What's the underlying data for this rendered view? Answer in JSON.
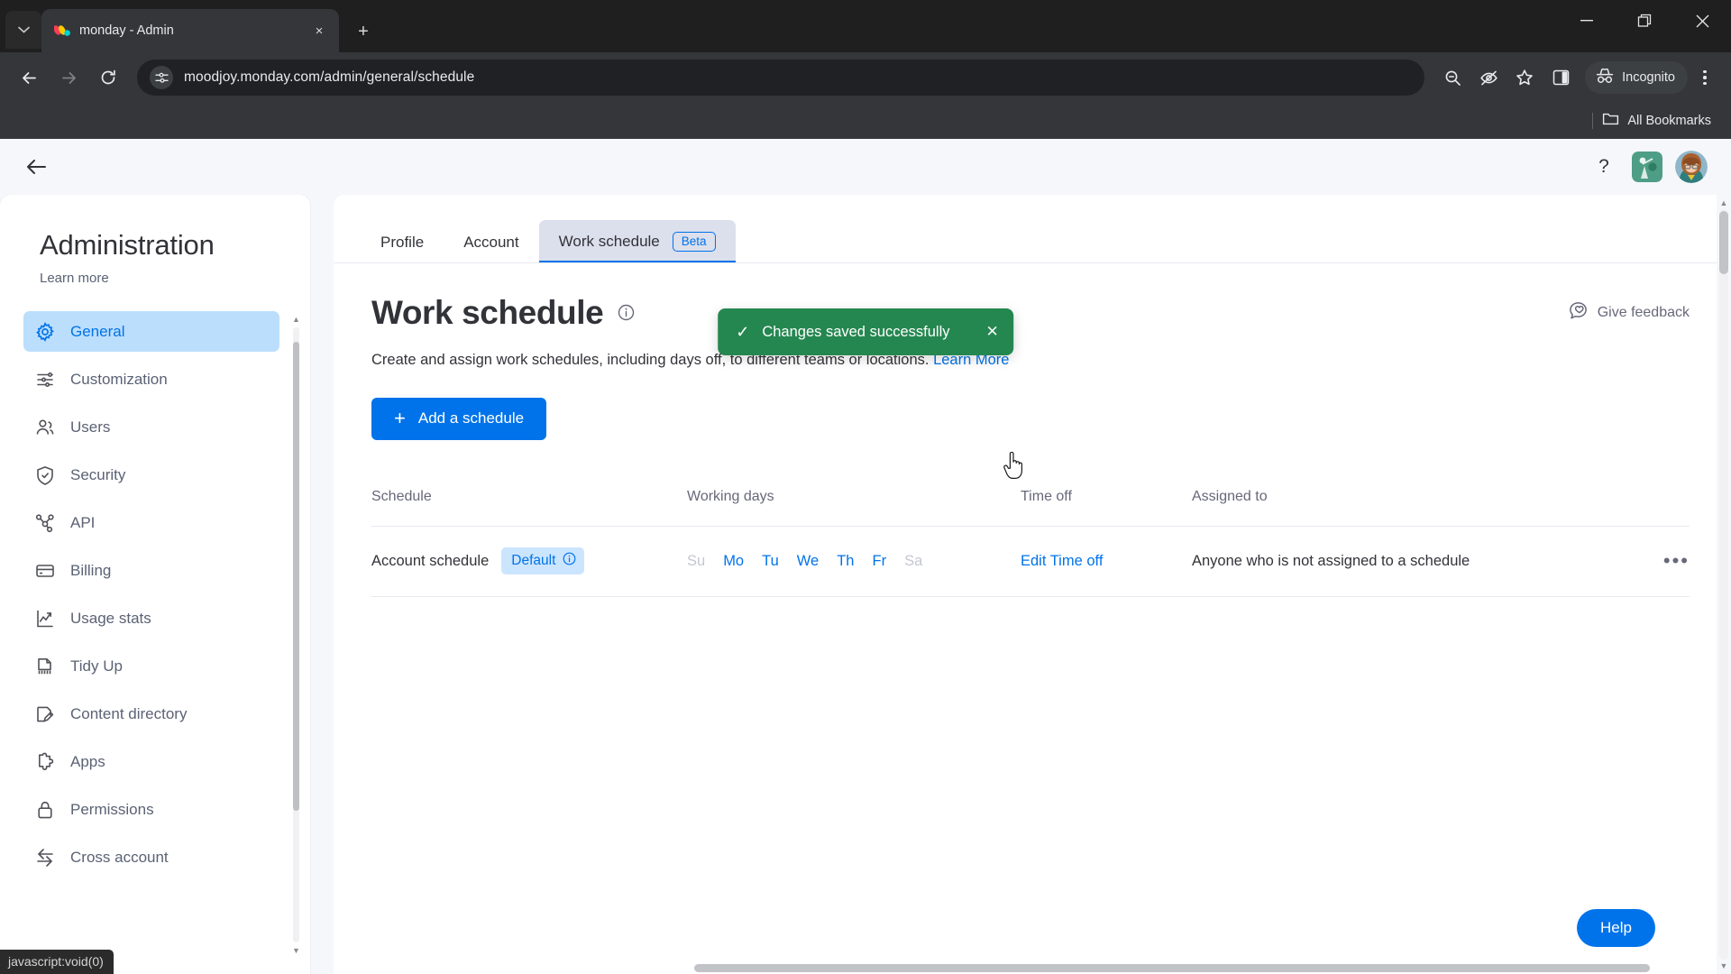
{
  "browser": {
    "tab": {
      "title": "monday - Admin",
      "favicon": "monday-logo-icon",
      "close": "×"
    },
    "new_tab": "+",
    "tab_list_chevron": "⌄",
    "window_controls": {
      "minimize": "—",
      "maximize": "❐",
      "close": "✕"
    },
    "nav": {
      "back": "←",
      "forward": "→",
      "reload": "↻"
    },
    "omnibox": {
      "url": "moodjoy.monday.com/admin/general/schedule",
      "site_info_icon": "page-info-icon"
    },
    "toolbar_icons": [
      "zoom-out-icon",
      "hide-password-icon",
      "bookmark-star-icon",
      "side-panel-icon"
    ],
    "incognito_label": "Incognito",
    "menu_icon": "three-dot-menu-icon",
    "bookmarks": {
      "all_bookmarks": "All Bookmarks",
      "folder_icon": "folder-icon"
    },
    "status_bar": "javascript:void(0)"
  },
  "app_header": {
    "back_label": "←",
    "help_icon": "question-mark-icon",
    "app_tile": "monday-app-icon",
    "avatar": "user-avatar"
  },
  "toast": {
    "message": "Changes saved successfully",
    "check": "✓",
    "close": "✕",
    "color": "#258750"
  },
  "sidebar": {
    "title": "Administration",
    "learn_more": "Learn more",
    "items": [
      {
        "label": "General",
        "icon": "gear-icon",
        "active": true
      },
      {
        "label": "Customization",
        "icon": "sliders-icon",
        "active": false
      },
      {
        "label": "Users",
        "icon": "users-icon",
        "active": false
      },
      {
        "label": "Security",
        "icon": "shield-check-icon",
        "active": false
      },
      {
        "label": "API",
        "icon": "api-nodes-icon",
        "active": false
      },
      {
        "label": "Billing",
        "icon": "credit-card-icon",
        "active": false
      },
      {
        "label": "Usage stats",
        "icon": "chart-line-icon",
        "active": false
      },
      {
        "label": "Tidy Up",
        "icon": "broom-icon",
        "active": false
      },
      {
        "label": "Content directory",
        "icon": "document-edit-icon",
        "active": false
      },
      {
        "label": "Apps",
        "icon": "puzzle-icon",
        "active": false
      },
      {
        "label": "Permissions",
        "icon": "lock-icon",
        "active": false
      },
      {
        "label": "Cross account",
        "icon": "cross-account-icon",
        "active": false
      }
    ]
  },
  "tabs": [
    {
      "label": "Profile",
      "active": false
    },
    {
      "label": "Account",
      "active": false
    },
    {
      "label": "Work schedule",
      "active": true,
      "badge": "Beta"
    }
  ],
  "page": {
    "title": "Work schedule",
    "info_icon": "info-circle-icon",
    "give_feedback": "Give feedback",
    "feedback_icon": "feedback-bubble-icon",
    "subtitle": "Create and assign work schedules, including days off, to different teams or locations.",
    "subtitle_link": "Learn More",
    "add_button": "Add a schedule",
    "add_button_plus": "+",
    "help_button": "Help"
  },
  "table": {
    "headers": [
      "Schedule",
      "Working days",
      "Time off",
      "Assigned to"
    ],
    "rows": [
      {
        "schedule": "Account schedule",
        "chip": "Default",
        "chip_icon": "info-circle-icon",
        "days": [
          {
            "label": "Su",
            "working": false
          },
          {
            "label": "Mo",
            "working": true
          },
          {
            "label": "Tu",
            "working": true
          },
          {
            "label": "We",
            "working": true
          },
          {
            "label": "Th",
            "working": true
          },
          {
            "label": "Fr",
            "working": true
          },
          {
            "label": "Sa",
            "working": false
          }
        ],
        "time_off": "Edit Time off",
        "assigned_to": "Anyone who is not assigned to a schedule",
        "more": "•••"
      }
    ]
  },
  "colors": {
    "accent": "#0073ea",
    "success": "#258750",
    "chip_bg": "#cce5ff",
    "sidebar_active_bg": "#bbdefc",
    "page_bg": "#f6f7fb",
    "text": "#323338",
    "muted": "#676879"
  }
}
